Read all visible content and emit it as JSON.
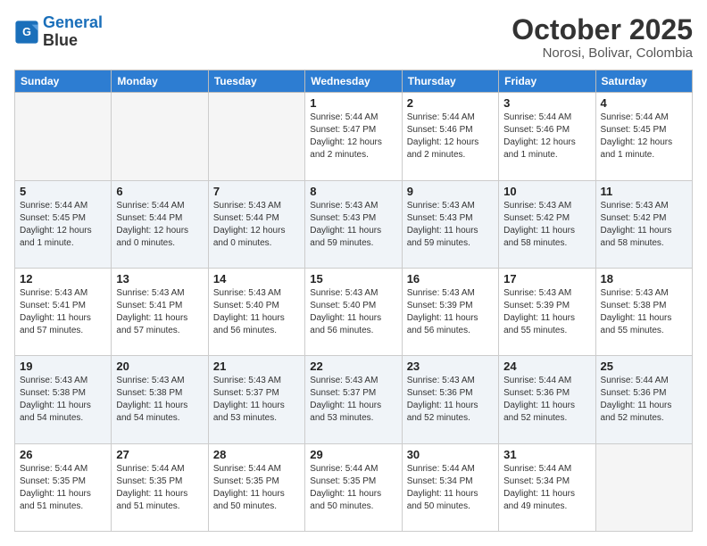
{
  "header": {
    "logo_line1": "General",
    "logo_line2": "Blue",
    "title": "October 2025",
    "subtitle": "Norosi, Bolivar, Colombia"
  },
  "weekdays": [
    "Sunday",
    "Monday",
    "Tuesday",
    "Wednesday",
    "Thursday",
    "Friday",
    "Saturday"
  ],
  "weeks": [
    [
      {
        "day": "",
        "info": ""
      },
      {
        "day": "",
        "info": ""
      },
      {
        "day": "",
        "info": ""
      },
      {
        "day": "1",
        "info": "Sunrise: 5:44 AM\nSunset: 5:47 PM\nDaylight: 12 hours\nand 2 minutes."
      },
      {
        "day": "2",
        "info": "Sunrise: 5:44 AM\nSunset: 5:46 PM\nDaylight: 12 hours\nand 2 minutes."
      },
      {
        "day": "3",
        "info": "Sunrise: 5:44 AM\nSunset: 5:46 PM\nDaylight: 12 hours\nand 1 minute."
      },
      {
        "day": "4",
        "info": "Sunrise: 5:44 AM\nSunset: 5:45 PM\nDaylight: 12 hours\nand 1 minute."
      }
    ],
    [
      {
        "day": "5",
        "info": "Sunrise: 5:44 AM\nSunset: 5:45 PM\nDaylight: 12 hours\nand 1 minute."
      },
      {
        "day": "6",
        "info": "Sunrise: 5:44 AM\nSunset: 5:44 PM\nDaylight: 12 hours\nand 0 minutes."
      },
      {
        "day": "7",
        "info": "Sunrise: 5:43 AM\nSunset: 5:44 PM\nDaylight: 12 hours\nand 0 minutes."
      },
      {
        "day": "8",
        "info": "Sunrise: 5:43 AM\nSunset: 5:43 PM\nDaylight: 11 hours\nand 59 minutes."
      },
      {
        "day": "9",
        "info": "Sunrise: 5:43 AM\nSunset: 5:43 PM\nDaylight: 11 hours\nand 59 minutes."
      },
      {
        "day": "10",
        "info": "Sunrise: 5:43 AM\nSunset: 5:42 PM\nDaylight: 11 hours\nand 58 minutes."
      },
      {
        "day": "11",
        "info": "Sunrise: 5:43 AM\nSunset: 5:42 PM\nDaylight: 11 hours\nand 58 minutes."
      }
    ],
    [
      {
        "day": "12",
        "info": "Sunrise: 5:43 AM\nSunset: 5:41 PM\nDaylight: 11 hours\nand 57 minutes."
      },
      {
        "day": "13",
        "info": "Sunrise: 5:43 AM\nSunset: 5:41 PM\nDaylight: 11 hours\nand 57 minutes."
      },
      {
        "day": "14",
        "info": "Sunrise: 5:43 AM\nSunset: 5:40 PM\nDaylight: 11 hours\nand 56 minutes."
      },
      {
        "day": "15",
        "info": "Sunrise: 5:43 AM\nSunset: 5:40 PM\nDaylight: 11 hours\nand 56 minutes."
      },
      {
        "day": "16",
        "info": "Sunrise: 5:43 AM\nSunset: 5:39 PM\nDaylight: 11 hours\nand 56 minutes."
      },
      {
        "day": "17",
        "info": "Sunrise: 5:43 AM\nSunset: 5:39 PM\nDaylight: 11 hours\nand 55 minutes."
      },
      {
        "day": "18",
        "info": "Sunrise: 5:43 AM\nSunset: 5:38 PM\nDaylight: 11 hours\nand 55 minutes."
      }
    ],
    [
      {
        "day": "19",
        "info": "Sunrise: 5:43 AM\nSunset: 5:38 PM\nDaylight: 11 hours\nand 54 minutes."
      },
      {
        "day": "20",
        "info": "Sunrise: 5:43 AM\nSunset: 5:38 PM\nDaylight: 11 hours\nand 54 minutes."
      },
      {
        "day": "21",
        "info": "Sunrise: 5:43 AM\nSunset: 5:37 PM\nDaylight: 11 hours\nand 53 minutes."
      },
      {
        "day": "22",
        "info": "Sunrise: 5:43 AM\nSunset: 5:37 PM\nDaylight: 11 hours\nand 53 minutes."
      },
      {
        "day": "23",
        "info": "Sunrise: 5:43 AM\nSunset: 5:36 PM\nDaylight: 11 hours\nand 52 minutes."
      },
      {
        "day": "24",
        "info": "Sunrise: 5:44 AM\nSunset: 5:36 PM\nDaylight: 11 hours\nand 52 minutes."
      },
      {
        "day": "25",
        "info": "Sunrise: 5:44 AM\nSunset: 5:36 PM\nDaylight: 11 hours\nand 52 minutes."
      }
    ],
    [
      {
        "day": "26",
        "info": "Sunrise: 5:44 AM\nSunset: 5:35 PM\nDaylight: 11 hours\nand 51 minutes."
      },
      {
        "day": "27",
        "info": "Sunrise: 5:44 AM\nSunset: 5:35 PM\nDaylight: 11 hours\nand 51 minutes."
      },
      {
        "day": "28",
        "info": "Sunrise: 5:44 AM\nSunset: 5:35 PM\nDaylight: 11 hours\nand 50 minutes."
      },
      {
        "day": "29",
        "info": "Sunrise: 5:44 AM\nSunset: 5:35 PM\nDaylight: 11 hours\nand 50 minutes."
      },
      {
        "day": "30",
        "info": "Sunrise: 5:44 AM\nSunset: 5:34 PM\nDaylight: 11 hours\nand 50 minutes."
      },
      {
        "day": "31",
        "info": "Sunrise: 5:44 AM\nSunset: 5:34 PM\nDaylight: 11 hours\nand 49 minutes."
      },
      {
        "day": "",
        "info": ""
      }
    ]
  ]
}
